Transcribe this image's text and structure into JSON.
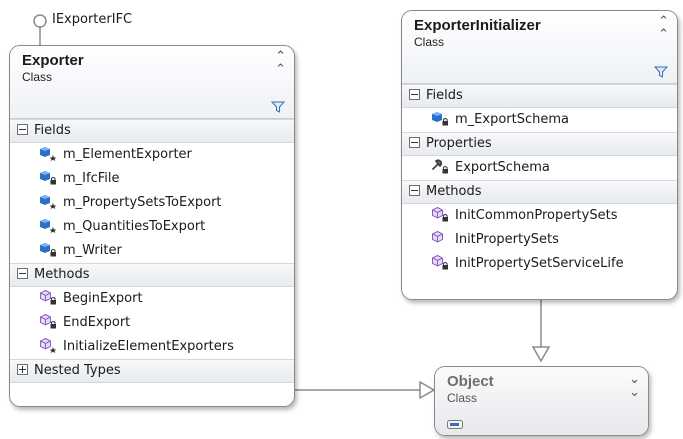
{
  "interface_lollipop": {
    "label": "IExporterIFC"
  },
  "exporter": {
    "title": "Exporter",
    "kind": "Class",
    "fields_header": "Fields",
    "fields": [
      {
        "name": "m_ElementExporter",
        "icon": "field-protected-icon"
      },
      {
        "name": "m_IfcFile",
        "icon": "field-private-icon"
      },
      {
        "name": "m_PropertySetsToExport",
        "icon": "field-protected-icon"
      },
      {
        "name": "m_QuantitiesToExport",
        "icon": "field-protected-icon"
      },
      {
        "name": "m_Writer",
        "icon": "field-private-icon"
      }
    ],
    "methods_header": "Methods",
    "methods": [
      {
        "name": "BeginExport",
        "icon": "method-private-icon"
      },
      {
        "name": "EndExport",
        "icon": "method-private-icon"
      },
      {
        "name": "InitializeElementExporters",
        "icon": "method-protected-icon"
      }
    ],
    "nested_header": "Nested Types"
  },
  "initializer": {
    "title": "ExporterInitializer",
    "kind": "Class",
    "fields_header": "Fields",
    "fields": [
      {
        "name": "m_ExportSchema",
        "icon": "field-private-icon"
      }
    ],
    "properties_header": "Properties",
    "properties": [
      {
        "name": "ExportSchema",
        "icon": "property-private-icon"
      }
    ],
    "methods_header": "Methods",
    "methods": [
      {
        "name": "InitCommonPropertySets",
        "icon": "method-private-icon"
      },
      {
        "name": "InitPropertySets",
        "icon": "method-public-icon"
      },
      {
        "name": "InitPropertySetServiceLife",
        "icon": "method-private-icon"
      }
    ]
  },
  "object": {
    "title": "Object",
    "kind": "Class"
  },
  "colors": {
    "field": "#2a6fc9",
    "method": "#8a5bc4",
    "property": "#4a4a4a",
    "connector": "#8a8a8a"
  }
}
